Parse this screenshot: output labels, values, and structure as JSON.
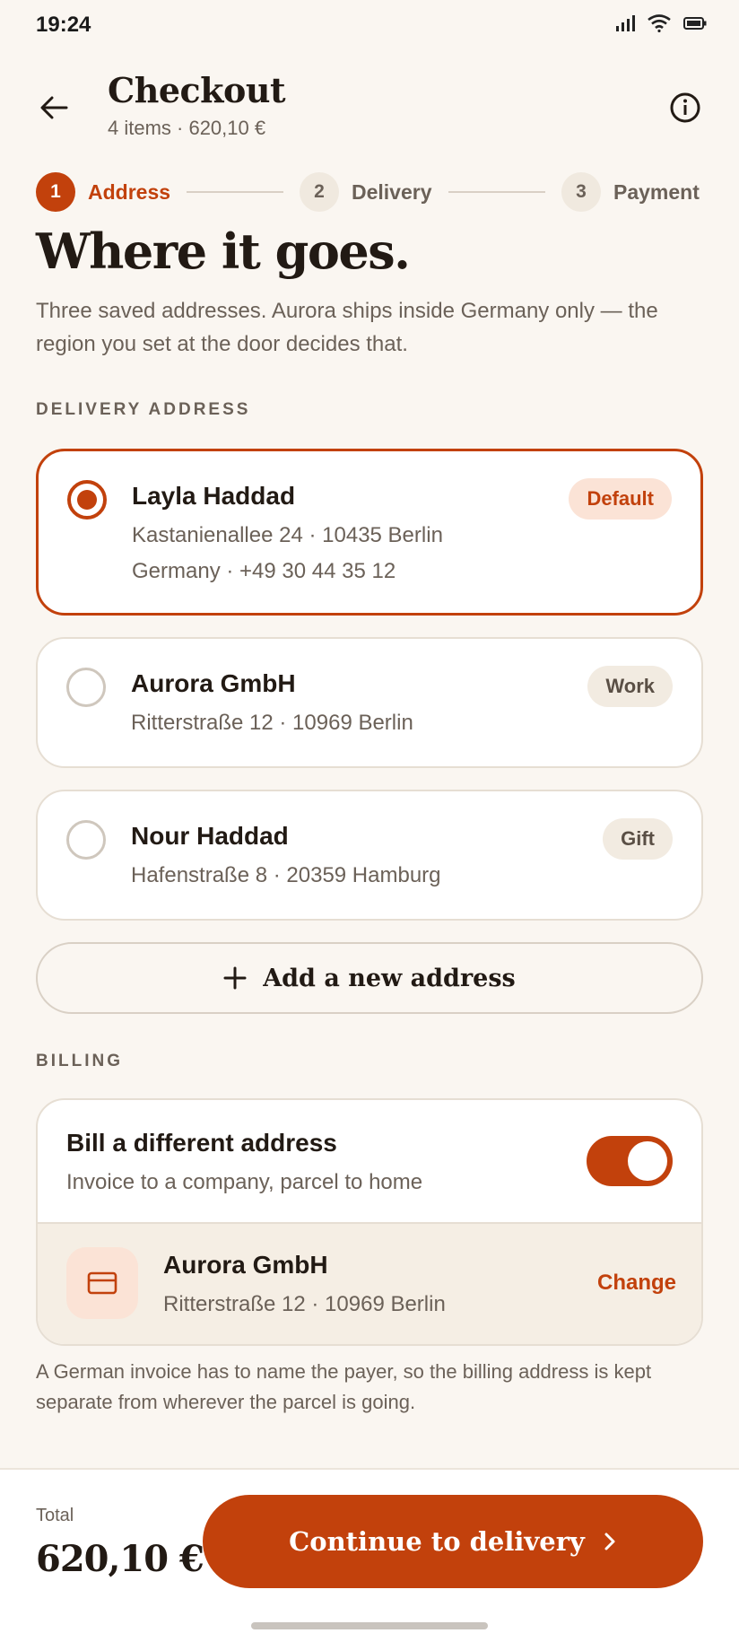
{
  "status_bar": {
    "time": "19:24",
    "icons": [
      "signal-icon",
      "wifi-icon",
      "battery-icon"
    ]
  },
  "header": {
    "title": "Checkout",
    "subtitle": "4 items · 620,10 €",
    "back_icon": "arrow-left-icon",
    "info_icon": "info-icon"
  },
  "stepper": [
    {
      "number": "1",
      "label": "Address",
      "state": "active"
    },
    {
      "number": "2",
      "label": "Delivery",
      "state": "todo"
    },
    {
      "number": "3",
      "label": "Payment",
      "state": "todo"
    }
  ],
  "heading": "Where it goes.",
  "lede": "Three saved addresses. Aurora ships inside Germany only — the region you set at the door decides that.",
  "delivery": {
    "section_label": "DELIVERY ADDRESS",
    "addresses": [
      {
        "name": "Layla Haddad",
        "line1": "Kastanienallee 24 · 10435 Berlin",
        "line2": "Germany · +49 30 44 35 12",
        "tag": "Default",
        "selected": true
      },
      {
        "name": "Aurora GmbH",
        "line1": "Ritterstraße 12 · 10969 Berlin",
        "tag": "Work",
        "selected": false
      },
      {
        "name": "Nour Haddad",
        "line1": "Hafenstraße 8 · 20359 Hamburg",
        "tag": "Gift",
        "selected": false
      }
    ],
    "add_label": "Add a new address"
  },
  "billing": {
    "section_label": "BILLING",
    "toggle_title": "Bill a different address",
    "toggle_subtitle": "Invoice to a company, parcel to home",
    "toggle_on": true,
    "address_name": "Aurora GmbH",
    "address_line": "Ritterstraße 12 · 10969 Berlin",
    "change_label": "Change",
    "note": "A German invoice has to name the payer, so the billing address is kept separate from wherever the parcel is going."
  },
  "footer": {
    "total_label": "Total",
    "total_value": "620,10 €",
    "cta_label": "Continue to delivery"
  },
  "colors": {
    "accent": "#C2410C",
    "background": "#FAF6F1",
    "muted": "#6B6158"
  }
}
